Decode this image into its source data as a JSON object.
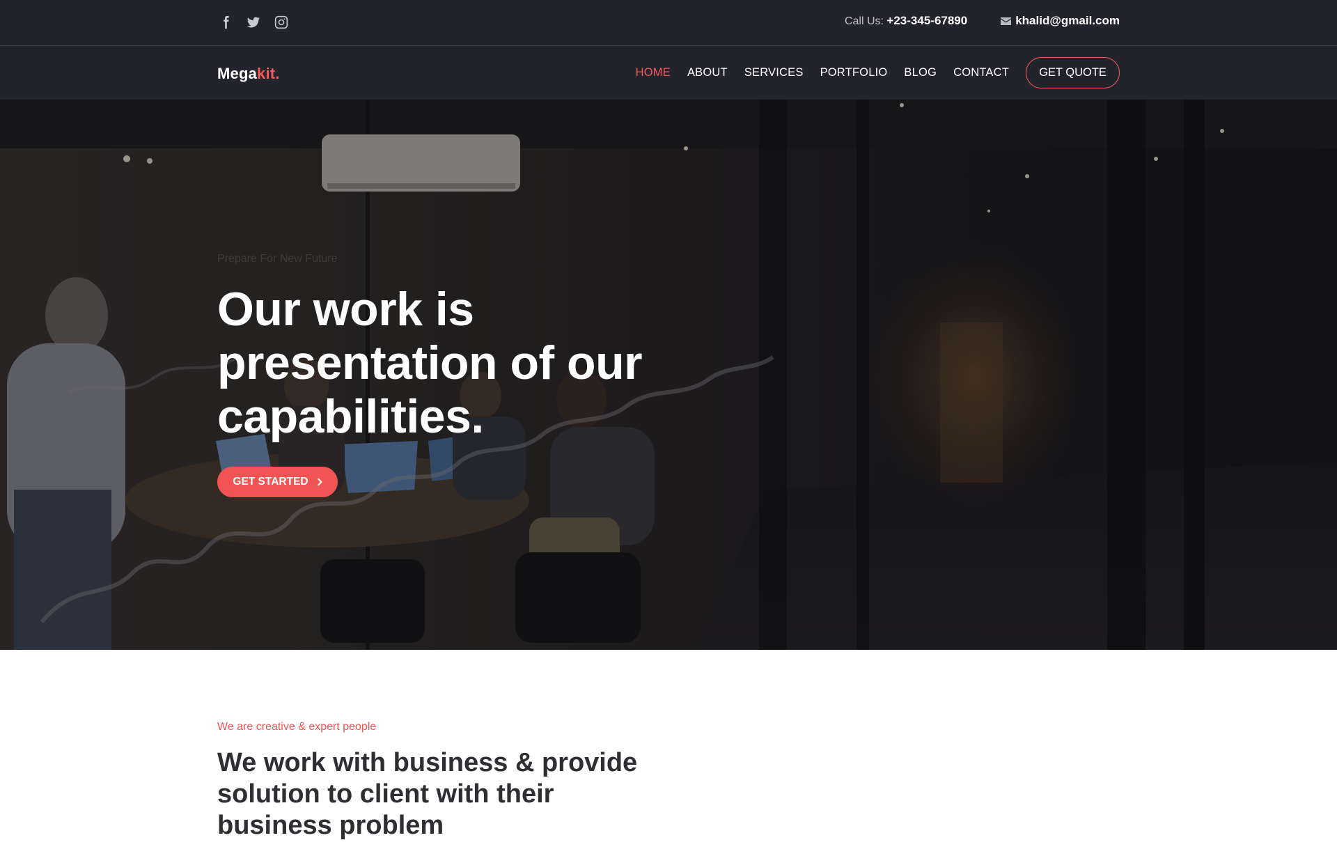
{
  "topbar": {
    "social": [
      {
        "icon": "facebook-icon"
      },
      {
        "icon": "twitter-icon"
      },
      {
        "icon": "instagram-icon"
      }
    ],
    "call_label": "Call Us:",
    "phone": "+23-345-67890",
    "email_icon": "mail-icon",
    "email": "khalid@gmail.com"
  },
  "nav": {
    "logo_main": "Mega",
    "logo_accent": "kit.",
    "items": [
      {
        "label": "HOME",
        "active": true
      },
      {
        "label": "ABOUT",
        "active": false
      },
      {
        "label": "SERVICES",
        "active": false
      },
      {
        "label": "PORTFOLIO",
        "active": false
      },
      {
        "label": "BLOG",
        "active": false
      },
      {
        "label": "CONTACT",
        "active": false
      }
    ],
    "quote_label": "GET QUOTE"
  },
  "hero": {
    "subtitle": "Prepare For New Future",
    "title_lines": [
      "Our work is",
      "presentation of our",
      "capabilities."
    ],
    "cta_label": "GET STARTED",
    "cta_icon": "chevron-right-icon"
  },
  "about": {
    "kicker": "We are creative & expert people",
    "title_lines": [
      "We work with business & provide",
      "solution to client with their",
      "business problem"
    ]
  },
  "colors": {
    "accent": "#f45a5a",
    "dark_bg": "#22232b",
    "heading": "#2e2e33"
  }
}
